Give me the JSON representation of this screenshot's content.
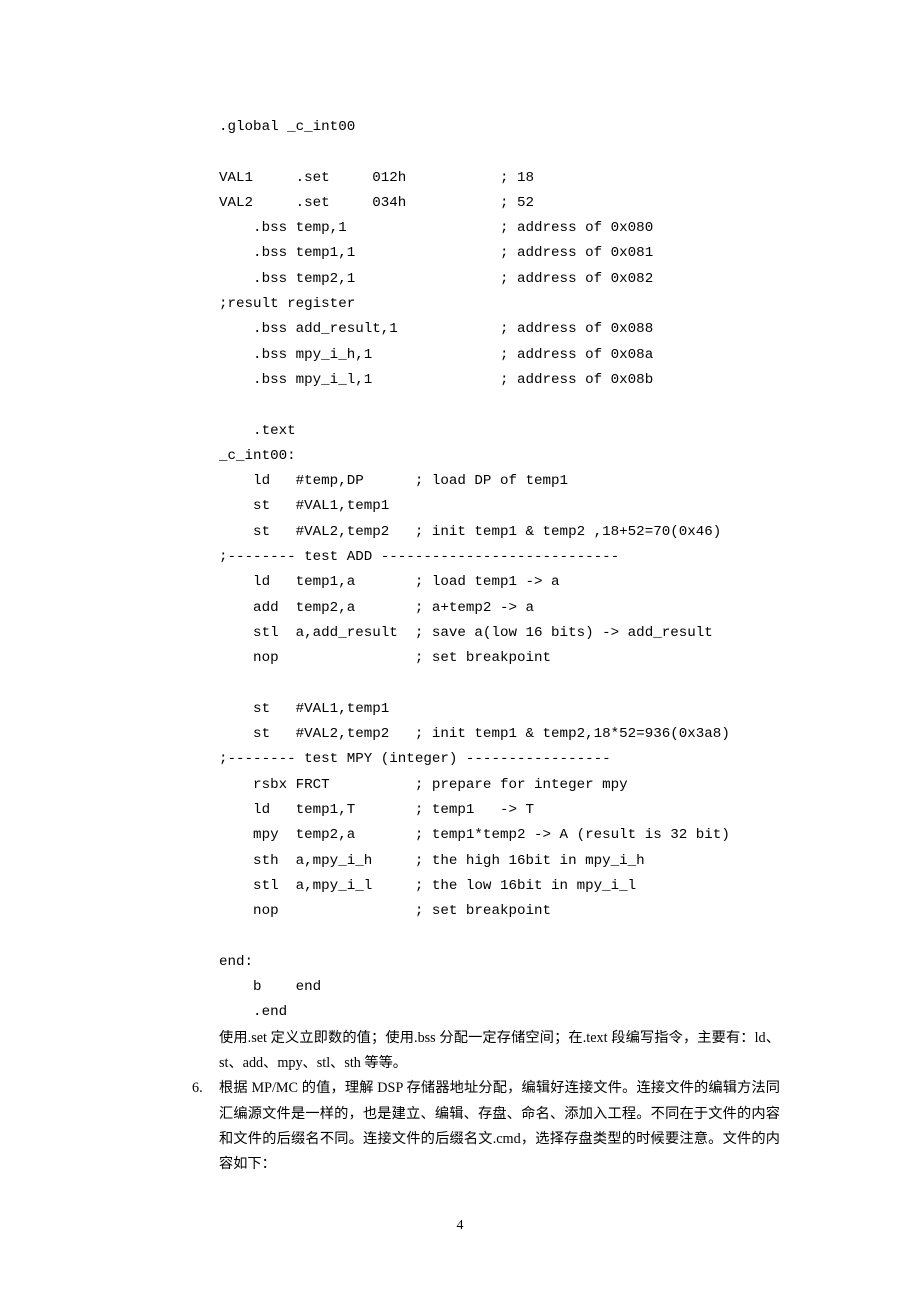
{
  "code": {
    "l1": ".global _c_int00",
    "l2": "VAL1     .set     012h           ; 18",
    "l3": "VAL2     .set     034h           ; 52",
    "l4": "    .bss temp,1                  ; address of 0x080",
    "l5": "    .bss temp1,1                 ; address of 0x081",
    "l6": "    .bss temp2,1                 ; address of 0x082",
    "l7": ";result register",
    "l8": "    .bss add_result,1            ; address of 0x088",
    "l9": "    .bss mpy_i_h,1               ; address of 0x08a",
    "l10": "    .bss mpy_i_l,1               ; address of 0x08b",
    "l11": "    .text",
    "l12": "_c_int00:",
    "l13": "    ld   #temp,DP      ; load DP of temp1",
    "l14": "    st   #VAL1,temp1",
    "l15": "    st   #VAL2,temp2   ; init temp1 & temp2 ,18+52=70(0x46)",
    "l16": ";-------- test ADD ----------------------------",
    "l17": "    ld   temp1,a       ; load temp1 -> a",
    "l18": "    add  temp2,a       ; a+temp2 -> a",
    "l19": "    stl  a,add_result  ; save a(low 16 bits) -> add_result",
    "l20": "    nop                ; set breakpoint",
    "l21": "    st   #VAL1,temp1",
    "l22": "    st   #VAL2,temp2   ; init temp1 & temp2,18*52=936(0x3a8)",
    "l23": ";-------- test MPY (integer) -----------------",
    "l24": "    rsbx FRCT          ; prepare for integer mpy",
    "l25": "    ld   temp1,T       ; temp1   -> T",
    "l26": "    mpy  temp2,a       ; temp1*temp2 -> A (result is 32 bit)",
    "l27": "    sth  a,mpy_i_h     ; the high 16bit in mpy_i_h",
    "l28": "    stl  a,mpy_i_l     ; the low 16bit in mpy_i_l",
    "l29": "    nop                ; set breakpoint",
    "l30": "end:",
    "l31": "    b    end",
    "l32": "    .end"
  },
  "prose": {
    "p1": "使用.set 定义立即数的值；使用.bss 分配一定存储空间；在.text 段编写指令，主要有：ld、st、add、mpy、stl、sth 等等。",
    "p2_num": "6.",
    "p2": "根据 MP/MC 的值，理解 DSP 存储器地址分配，编辑好连接文件。连接文件的编辑方法同汇编源文件是一样的，也是建立、编辑、存盘、命名、添加入工程。不同在于文件的内容和文件的后缀名不同。连接文件的后缀名文.cmd，选择存盘类型的时候要注意。文件的内容如下："
  },
  "page_number": "4"
}
